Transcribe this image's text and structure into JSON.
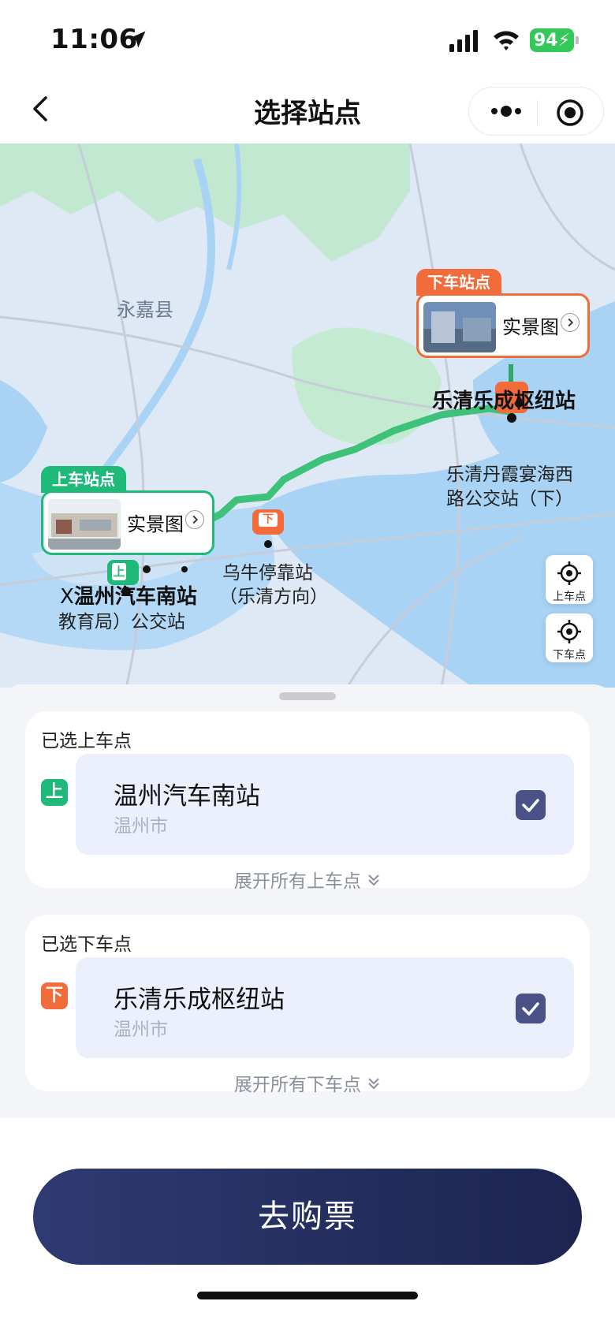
{
  "status": {
    "time": "11:06",
    "battery": "94"
  },
  "nav": {
    "title": "选择站点"
  },
  "map": {
    "county_label": "永嘉县",
    "dropoff_tag": "下车站点",
    "pickup_tag": "上车站点",
    "photo_label": "实景图",
    "dropoff_station": "乐清乐成枢纽站",
    "dropoff_nearby_line1": "乐清丹霞宴海西",
    "dropoff_nearby_line2": "路公交站（下）",
    "mid_stop_line1": "乌牛停靠站",
    "mid_stop_line2": "（乐清方向）",
    "pickup_station": "温州汽车南站",
    "pickup_nearby_prefix": "X",
    "pickup_nearby_line2": "教育局）公交站",
    "locate_pickup": "上车点",
    "locate_dropoff": "下车点",
    "marker_up": "上",
    "marker_down": "下"
  },
  "pickup_card": {
    "title": "已选上车点",
    "badge": "上",
    "station": "温州汽车南站",
    "city": "温州市",
    "expand": "展开所有上车点"
  },
  "dropoff_card": {
    "title": "已选下车点",
    "badge": "下",
    "station": "乐清乐成枢纽站",
    "city": "温州市",
    "expand": "展开所有下车点"
  },
  "buy_button": "去购票",
  "colors": {
    "green": "#1fb97a",
    "orange": "#f26b3a",
    "navy": "#2e3a72",
    "route": "#3ec27a"
  },
  "icons": {
    "location": "location-arrow-icon",
    "signal": "signal-icon",
    "wifi": "wifi-icon",
    "back": "chevron-left-icon",
    "more": "more-icon",
    "target": "target-icon",
    "locate": "locate-icon",
    "check": "check-icon",
    "expand": "double-chevron-down-icon"
  }
}
